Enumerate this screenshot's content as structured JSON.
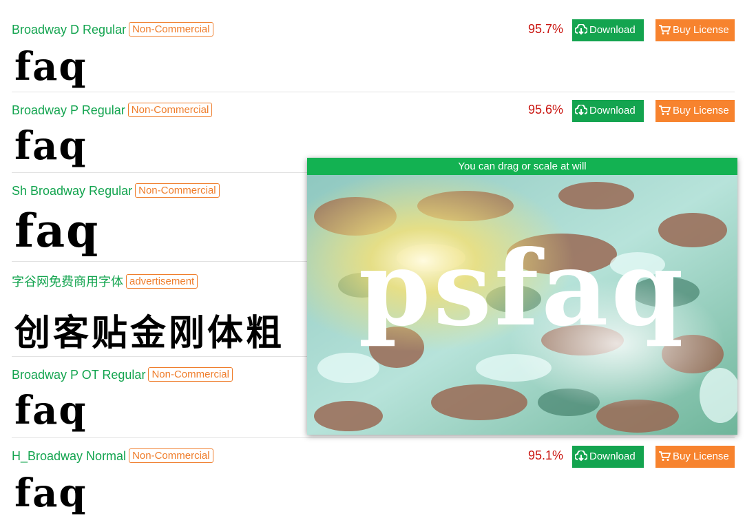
{
  "fonts": [
    {
      "name": "Broadway D Regular",
      "badge": "Non-Commercial",
      "score": "95.7%",
      "sample": "faq",
      "download": "Download",
      "buy": "Buy License"
    },
    {
      "name": "Broadway P Regular",
      "badge": "Non-Commercial",
      "score": "95.6%",
      "sample": "faq",
      "download": "Download",
      "buy": "Buy License"
    },
    {
      "name": "Sh Broadway Regular",
      "badge": "Non-Commercial",
      "sample": "faq"
    },
    {
      "name": "字谷网免费商用字体",
      "badge": "advertisement",
      "sample": "创客贴金刚体粗"
    },
    {
      "name": "Broadway P OT Regular",
      "badge": "Non-Commercial",
      "sample": "faq"
    },
    {
      "name": "H_Broadway Normal",
      "badge": "Non-Commercial",
      "score": "95.1%",
      "sample": "faq",
      "download": "Download",
      "buy": "Buy License"
    }
  ],
  "viewer": {
    "hint": "You can drag or scale at will",
    "text": "psfaq"
  },
  "colors": {
    "green": "#13a44f",
    "orange": "#f7832e",
    "score": "#c9140f"
  },
  "icons": {
    "download": "cloud-download-icon",
    "buy": "cart-icon"
  }
}
